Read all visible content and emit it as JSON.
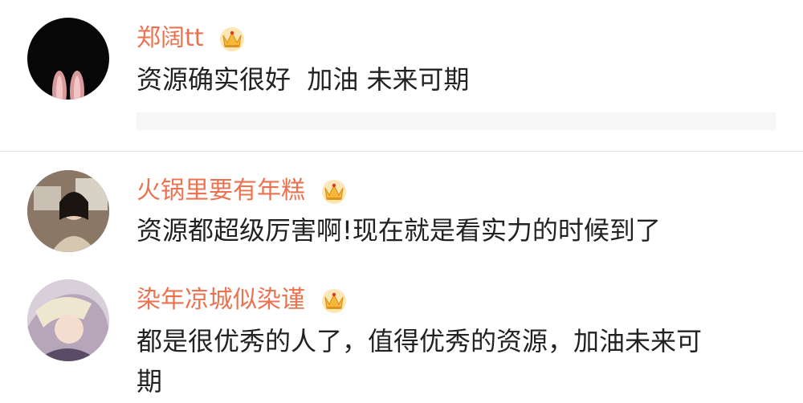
{
  "comments": [
    {
      "username": "郑阔tt",
      "text": "资源确实很好  加油 未来可期",
      "badge_icon": "vip-crown-icon"
    },
    {
      "username": "火锅里要有年糕",
      "text": "资源都超级厉害啊!现在就是看实力的时候到了",
      "badge_icon": "vip-crown-icon"
    },
    {
      "username": "染年凉城似染谨",
      "text_line1": "都是很优秀的人了，值得优秀的资源，加油未来可",
      "text_line2": "期",
      "badge_icon": "vip-crown-icon"
    }
  ],
  "colors": {
    "username": "#eb7350",
    "text": "#222222",
    "crown": "#f5b83a",
    "divider": "#e6e6e6"
  }
}
